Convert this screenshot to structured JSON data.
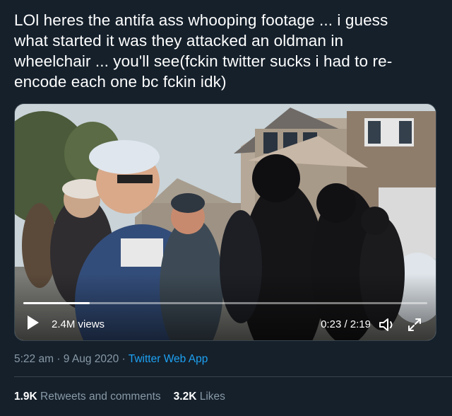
{
  "tweet": {
    "text": "LOl heres the antifa ass whooping footage ... i guess\nwhat started it was they attacked an oldman in\nwheelchair ... you'll see(fckin twitter sucks i had to re-\nencode each one bc fckin idk)"
  },
  "video": {
    "views": "2.4M views",
    "time": "0:23 / 2:19",
    "progress": 0.165
  },
  "meta": {
    "time": "5:22 am",
    "separator": " · ",
    "date": "9 Aug 2020",
    "app": "Twitter Web App"
  },
  "stats": {
    "retweets_count": "1.9K",
    "retweets_label": " Retweets and comments",
    "likes_count": "3.2K",
    "likes_label": " Likes"
  },
  "colors": {
    "background": "#15202b",
    "secondary_text": "#8899a6",
    "link": "#1da1f2",
    "divider": "#38444d"
  }
}
